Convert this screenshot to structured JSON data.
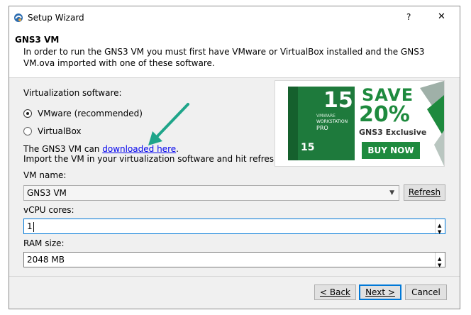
{
  "window": {
    "title": "Setup Wizard",
    "help": "?",
    "close": "✕"
  },
  "header": {
    "title": "GNS3 VM",
    "description": "In order to run the GNS3 VM you must first have VMware or VirtualBox installed and the GNS3 VM.ova imported with one of these software."
  },
  "virt": {
    "label": "Virtualization software:",
    "options": [
      {
        "label": "VMware (recommended)",
        "selected": true
      },
      {
        "label": "VirtualBox",
        "selected": false
      }
    ]
  },
  "info": {
    "prefix": "The GNS3 VM can ",
    "link": "downloaded here",
    "suffix": ".",
    "line2": "Import the VM in your virtualization software and hit refresh."
  },
  "banner": {
    "version": "15",
    "box_line1": "VMWARE",
    "box_line2": "WORKSTATION",
    "box_line3": "PRO",
    "save": "SAVE",
    "percent": "20%",
    "exclusive": "GNS3 Exclusive",
    "cta": "BUY NOW",
    "green": "#1e8a3e"
  },
  "vm": {
    "label": "VM name:",
    "value": "GNS3 VM",
    "refresh": "Refresh"
  },
  "vcpu": {
    "label": "vCPU cores:",
    "value": "1"
  },
  "ram": {
    "label": "RAM size:",
    "value": "2048 MB"
  },
  "footer": {
    "back": "< Back",
    "next": "Next >",
    "cancel": "Cancel"
  }
}
